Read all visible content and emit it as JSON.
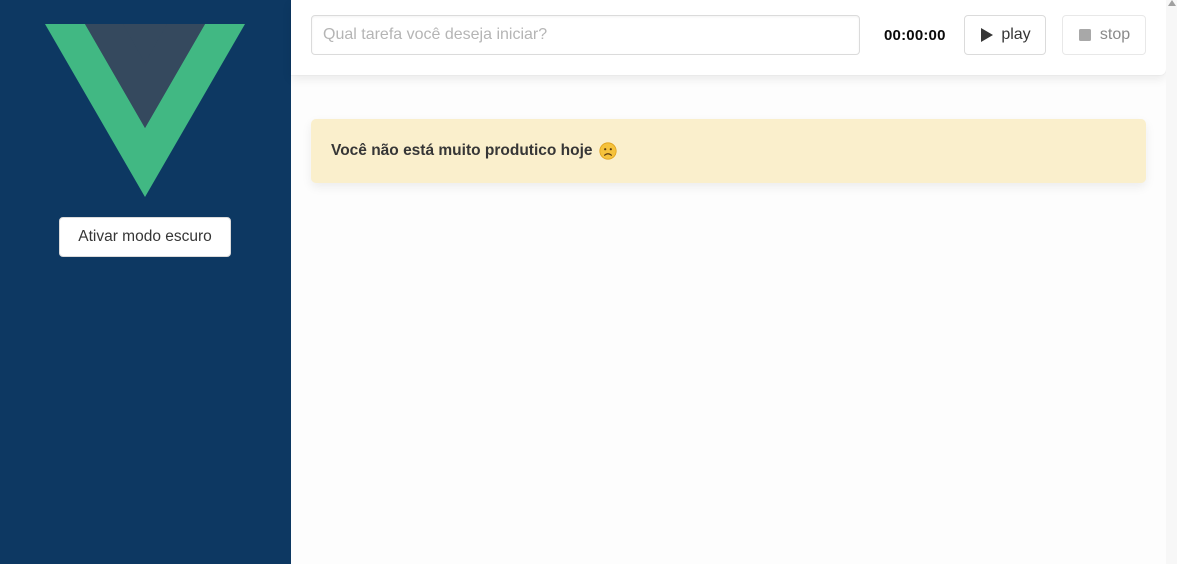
{
  "sidebar": {
    "theme_button_label": "Ativar modo escuro",
    "colors": {
      "background": "#0d3862",
      "logo_green": "#41b883",
      "logo_dark": "#35495e"
    }
  },
  "topbar": {
    "task_input": {
      "value": "",
      "placeholder": "Qual tarefa você deseja iniciar?"
    },
    "timer": "00:00:00",
    "play_label": "play",
    "stop_label": "stop",
    "icons": {
      "play": "play-icon",
      "stop": "stop-icon"
    }
  },
  "notice": {
    "text": "Você não está muito produtico hoje",
    "emoji_icon": "sad-face-icon",
    "colors": {
      "background": "#faefcc"
    }
  }
}
